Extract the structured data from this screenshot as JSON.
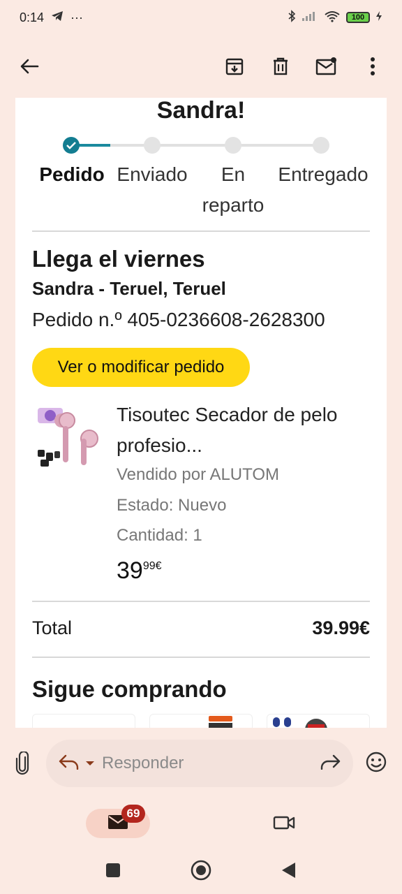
{
  "status": {
    "time": "0:14",
    "dots": "···",
    "battery": "100",
    "icons": [
      "telegram-icon",
      "bluetooth-icon",
      "signal-icon",
      "wifi-icon",
      "battery-icon",
      "charging-icon"
    ]
  },
  "app_bar": {
    "icons": [
      "back-arrow-icon",
      "archive-icon",
      "delete-icon",
      "mark-unread-icon",
      "more-vert-icon"
    ]
  },
  "email": {
    "greeting": "Sandra!",
    "steps": [
      {
        "label": "Pedido",
        "state": "done"
      },
      {
        "label": "Enviado",
        "state": "pending"
      },
      {
        "label": "En reparto",
        "state": "pending"
      },
      {
        "label": "Entregado",
        "state": "pending"
      }
    ],
    "arrival": "Llega el viernes",
    "recipient": "Sandra - Teruel, Teruel",
    "order_number": "Pedido n.º 405-0236608-2628300",
    "order_button": "Ver o modificar pedido",
    "product": {
      "title": "Tisoutec Secador de pelo profesio...",
      "seller": "Vendido por ALUTOM",
      "condition": "Estado: Nuevo",
      "quantity": "Cantidad: 1",
      "price_whole": "39",
      "price_fraction": "99€"
    },
    "total_label": "Total",
    "total_value": "39.99€",
    "keep_shopping": "Sigue comprando"
  },
  "reply": {
    "placeholder": "Responder"
  },
  "bottom_nav": {
    "mail_badge": "69"
  },
  "colors": {
    "background": "#fbeae3",
    "accent_teal": "#137d91",
    "amazon_yellow": "#ffd814",
    "badge_red": "#b3261e"
  }
}
